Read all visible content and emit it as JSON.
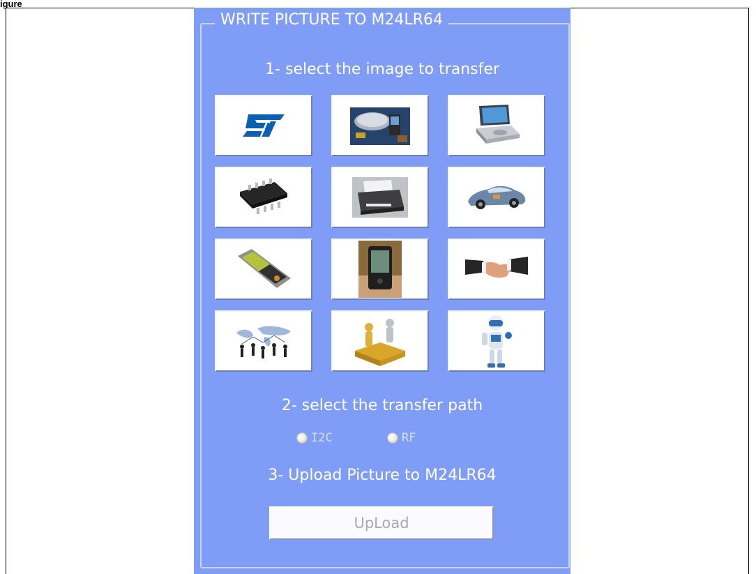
{
  "figure_label": "igure",
  "panel": {
    "title": "WRITE PICTURE TO M24LR64",
    "step1": "1- select the image to transfer",
    "step2": "2- select the transfer path",
    "step3": "3- Upload Picture to M24LR64",
    "images": [
      {
        "icon": "st-logo-icon"
      },
      {
        "icon": "chip-wafer-phone-icon"
      },
      {
        "icon": "portable-dvd-player-icon"
      },
      {
        "icon": "soic-chip-icon"
      },
      {
        "icon": "printer-icon"
      },
      {
        "icon": "car-icon"
      },
      {
        "icon": "handheld-device-icon"
      },
      {
        "icon": "pda-in-hand-icon"
      },
      {
        "icon": "handshake-icon"
      },
      {
        "icon": "world-network-icon"
      },
      {
        "icon": "puzzle-people-icon"
      },
      {
        "icon": "robot-icon"
      }
    ],
    "transfer_paths": [
      {
        "label": "I2C",
        "selected": false
      },
      {
        "label": "RF",
        "selected": false
      }
    ],
    "upload_label": "UpLoad"
  },
  "colors": {
    "panel_bg": "#7f9df7",
    "text": "#ffffff",
    "st_blue": "#0a60b5"
  }
}
